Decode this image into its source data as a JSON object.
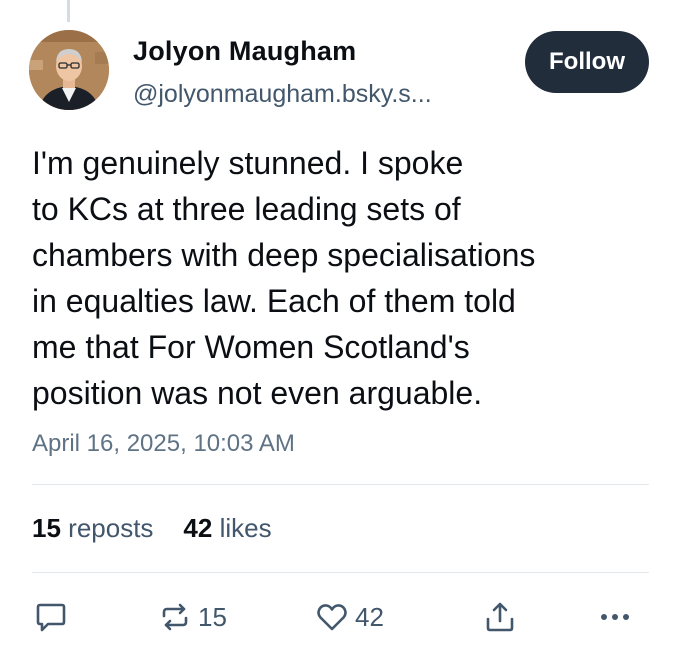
{
  "author": {
    "name": "Jolyon Maugham",
    "handle": "@jolyonmaugham.bsky.s..."
  },
  "follow_label": "Follow",
  "post": {
    "lines": [
      "I'm genuinely stunned. I spoke",
      "to KCs at three leading sets of",
      "chambers with deep specialisations",
      "in equalties law. Each of them told",
      "me that For Women Scotland's",
      "position was not even arguable."
    ],
    "timestamp": "April 16, 2025, 10:03 AM"
  },
  "stats": {
    "reposts_count": "15",
    "reposts_label": "reposts",
    "likes_count": "42",
    "likes_label": "likes"
  },
  "actions": {
    "reply": {
      "icon": "reply-icon"
    },
    "repost": {
      "icon": "repost-icon",
      "count": "15"
    },
    "like": {
      "icon": "heart-icon",
      "count": "42"
    },
    "share": {
      "icon": "share-icon"
    },
    "more": {
      "icon": "more-icon"
    }
  },
  "colors": {
    "follow_button_bg": "#212d3b",
    "secondary_text": "#42576c",
    "timestamp_text": "#5f7385",
    "divider": "#e3e8ed"
  }
}
